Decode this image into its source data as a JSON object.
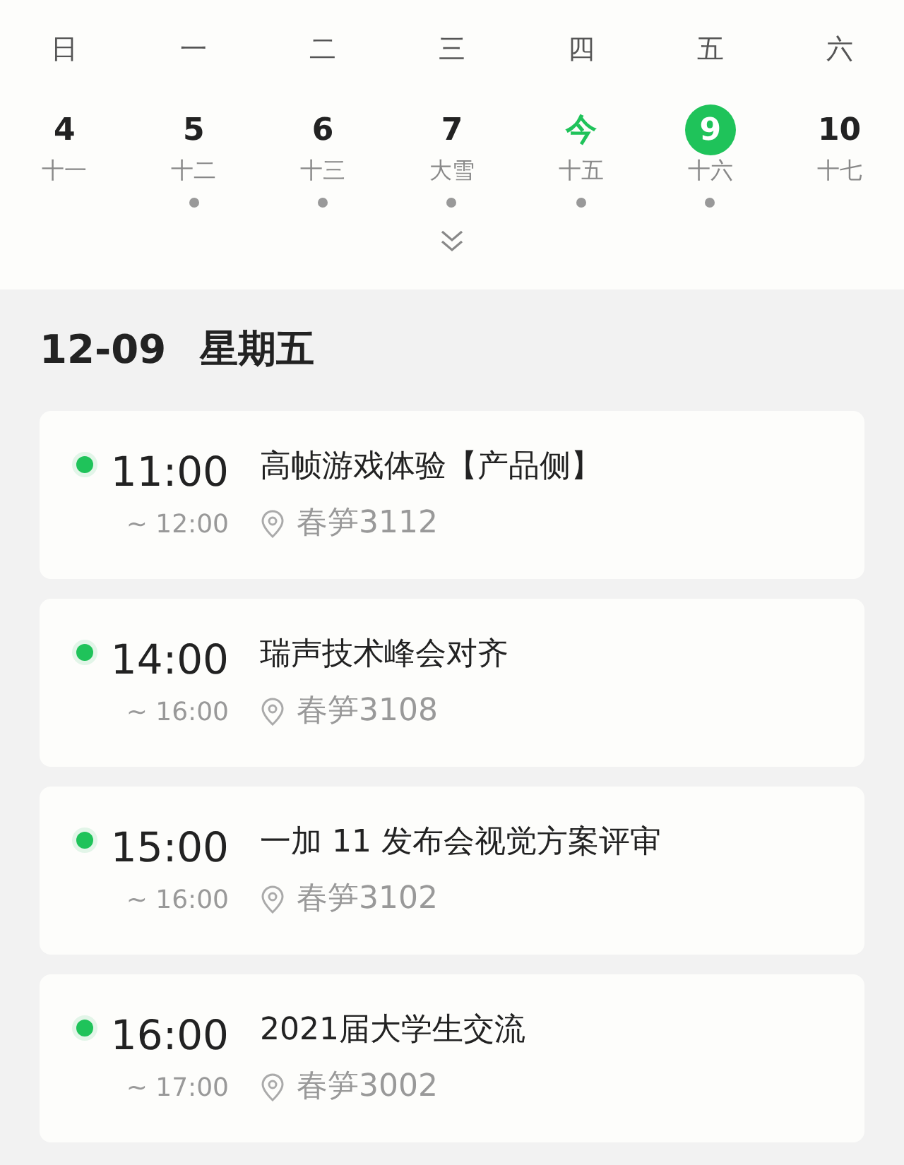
{
  "week": {
    "weekdays": [
      "日",
      "一",
      "二",
      "三",
      "四",
      "五",
      "六"
    ],
    "days": [
      {
        "day": "4",
        "lunar": "十一",
        "has_event": false,
        "today": false,
        "selected": false
      },
      {
        "day": "5",
        "lunar": "十二",
        "has_event": true,
        "today": false,
        "selected": false
      },
      {
        "day": "6",
        "lunar": "十三",
        "has_event": true,
        "today": false,
        "selected": false
      },
      {
        "day": "7",
        "lunar": "大雪",
        "has_event": true,
        "today": false,
        "selected": false
      },
      {
        "day": "今",
        "lunar": "十五",
        "has_event": true,
        "today": true,
        "selected": false
      },
      {
        "day": "9",
        "lunar": "十六",
        "has_event": true,
        "today": false,
        "selected": true
      },
      {
        "day": "10",
        "lunar": "十七",
        "has_event": false,
        "today": false,
        "selected": false
      }
    ]
  },
  "agenda": {
    "date": "12-09",
    "weekday": "星期五",
    "events": [
      {
        "start": "11:00",
        "end": "~ 12:00",
        "title": "高帧游戏体验【产品侧】",
        "location": "春笋3112",
        "color": "#1fc35a"
      },
      {
        "start": "14:00",
        "end": "~ 16:00",
        "title": "瑞声技术峰会对齐",
        "location": "春笋3108",
        "color": "#1fc35a"
      },
      {
        "start": "15:00",
        "end": "~ 16:00",
        "title": "一加 11 发布会视觉方案评审",
        "location": "春笋3102",
        "color": "#1fc35a"
      },
      {
        "start": "16:00",
        "end": "~ 17:00",
        "title": "2021届大学生交流",
        "location": "春笋3002",
        "color": "#1fc35a"
      }
    ]
  }
}
